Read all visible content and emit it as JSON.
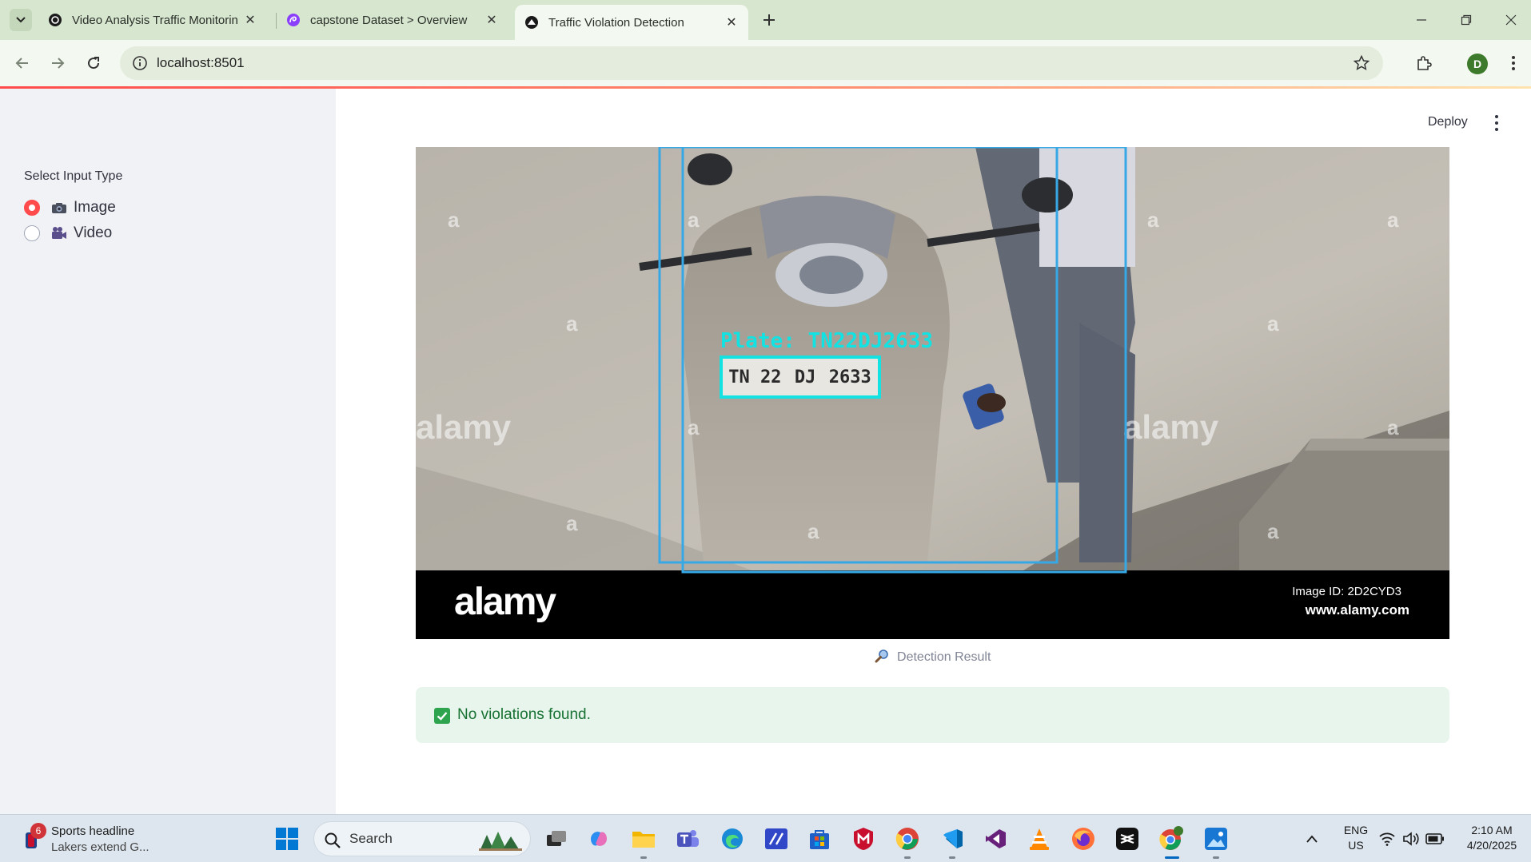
{
  "browser": {
    "tabs": [
      {
        "title": "Video Analysis Traffic Monitorin",
        "active": false
      },
      {
        "title": "capstone Dataset > Overview",
        "active": false
      },
      {
        "title": "Traffic Violation Detection",
        "active": true
      }
    ],
    "url": "localhost:8501",
    "profile_initial": "D"
  },
  "app": {
    "deploy_label": "Deploy",
    "sidebar": {
      "label": "Select Input Type",
      "options": [
        {
          "label": "Image",
          "checked": true,
          "icon": "camera-icon"
        },
        {
          "label": "Video",
          "checked": false,
          "icon": "video-camera-icon"
        }
      ]
    },
    "image": {
      "plate_label": "Plate: TN22DJ2633",
      "plate_text": [
        "TN 22",
        "DJ",
        "2633"
      ],
      "watermark_logo": "alamy",
      "image_id": "Image ID: 2D2CYD3",
      "site": "www.alamy.com"
    },
    "caption": "Detection Result",
    "result": "No violations found.",
    "colors": {
      "primary": "#ff4b4b",
      "success_bg": "#e8f5ec",
      "success_text": "#177233",
      "box_plate": "#13e2e2",
      "box_vehicle": "#36a8e6"
    }
  },
  "taskbar": {
    "news_badge": "6",
    "news_title": "Sports headline",
    "news_sub": "Lakers extend G...",
    "search_placeholder": "Search",
    "lang_line1": "ENG",
    "lang_line2": "US",
    "time": "2:10 AM",
    "date": "4/20/2025"
  }
}
